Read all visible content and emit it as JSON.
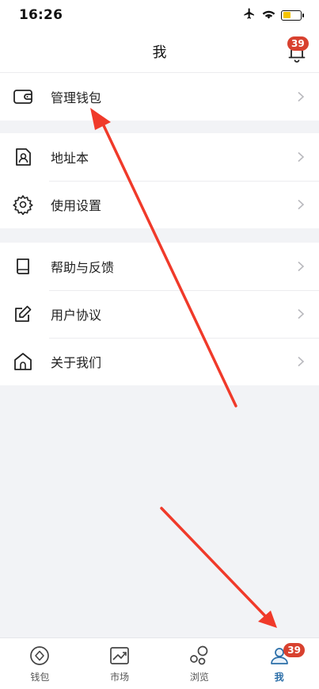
{
  "status_bar": {
    "time": "16:26"
  },
  "header": {
    "title": "我",
    "notification_count": "39"
  },
  "groups": [
    {
      "items": [
        {
          "label": "管理钱包",
          "icon": "wallet-icon"
        }
      ]
    },
    {
      "items": [
        {
          "label": "地址本",
          "icon": "address-book-icon"
        },
        {
          "label": "使用设置",
          "icon": "gear-icon"
        }
      ]
    },
    {
      "items": [
        {
          "label": "帮助与反馈",
          "icon": "book-icon"
        },
        {
          "label": "用户协议",
          "icon": "edit-icon"
        },
        {
          "label": "关于我们",
          "icon": "home-icon"
        }
      ]
    }
  ],
  "tab_bar": {
    "tabs": [
      {
        "label": "钱包",
        "icon": "wallet-tab-icon"
      },
      {
        "label": "市场",
        "icon": "chart-tab-icon"
      },
      {
        "label": "浏览",
        "icon": "browse-tab-icon"
      },
      {
        "label": "我",
        "icon": "profile-tab-icon",
        "active": true
      }
    ],
    "me_badge": "39"
  },
  "colors": {
    "accent": "#2b6ea8",
    "badge": "#d8412f",
    "arrow": "#f03a2a",
    "background": "#f2f3f6"
  }
}
